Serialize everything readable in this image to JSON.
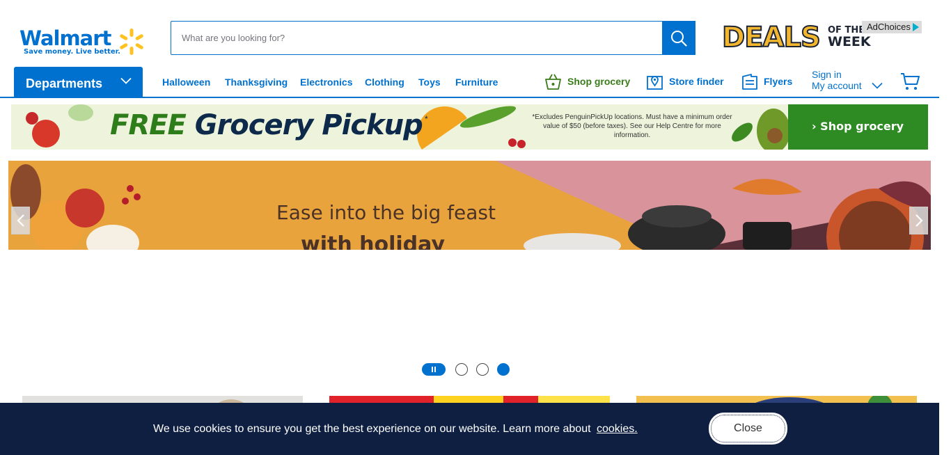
{
  "header": {
    "logo_word": "Walmart",
    "logo_tagline": "Save money. Live better.",
    "search_placeholder": "What are you looking for?",
    "ad": {
      "deals": "DEALS",
      "of_the": "OF THE",
      "week": "WEEK",
      "adchoices": "AdChoices"
    }
  },
  "nav": {
    "departments_label": "Departments",
    "links": [
      "Halloween",
      "Thanksgiving",
      "Electronics",
      "Clothing",
      "Toys",
      "Furniture"
    ],
    "shop_grocery": "Shop grocery",
    "store_finder": "Store finder",
    "flyers": "Flyers",
    "sign_in": "Sign in",
    "my_account": "My account"
  },
  "grocery_banner": {
    "title_free": "FREE ",
    "title_rest": "Grocery Pickup",
    "asterisk": "*",
    "fine_print": "*Excludes PenguinPickUp locations. Must have a minimum order value of $50 (before taxes). See our Help Centre for more information.",
    "cta": "› Shop grocery"
  },
  "hero": {
    "line1": "Ease into the big feast",
    "line2": "with holiday"
  },
  "carousel": {
    "slide_count": 3,
    "active_index": 2
  },
  "cookie_bar": {
    "message": "We use cookies to ensure you get the best experience on our website. Learn more about",
    "link": "cookies.",
    "close": "Close"
  },
  "colors": {
    "brand_blue": "#0071ce",
    "spark_yellow": "#ffc220",
    "grocery_green": "#2e8b23",
    "cookie_bg": "#0e1f42",
    "hero_orange": "#e9a33c",
    "hero_pink": "#d9939a"
  }
}
